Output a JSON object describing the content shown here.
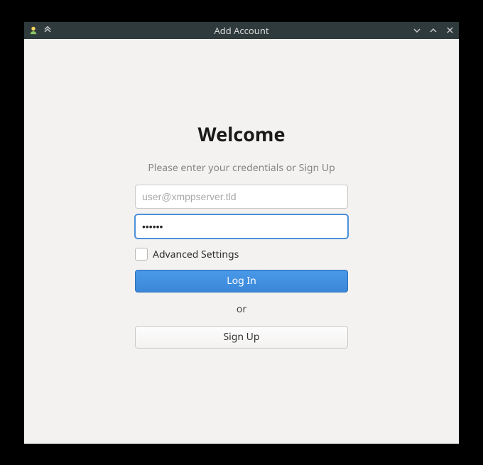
{
  "window": {
    "title": "Add Account"
  },
  "heading": "Welcome",
  "subtitle": "Please enter your credentials or Sign Up",
  "form": {
    "username_placeholder": "user@xmppserver.tld",
    "username_value": "",
    "password_value": "••••••",
    "advanced_label": "Advanced Settings",
    "login_label": "Log In",
    "or_label": "or",
    "signup_label": "Sign Up"
  }
}
